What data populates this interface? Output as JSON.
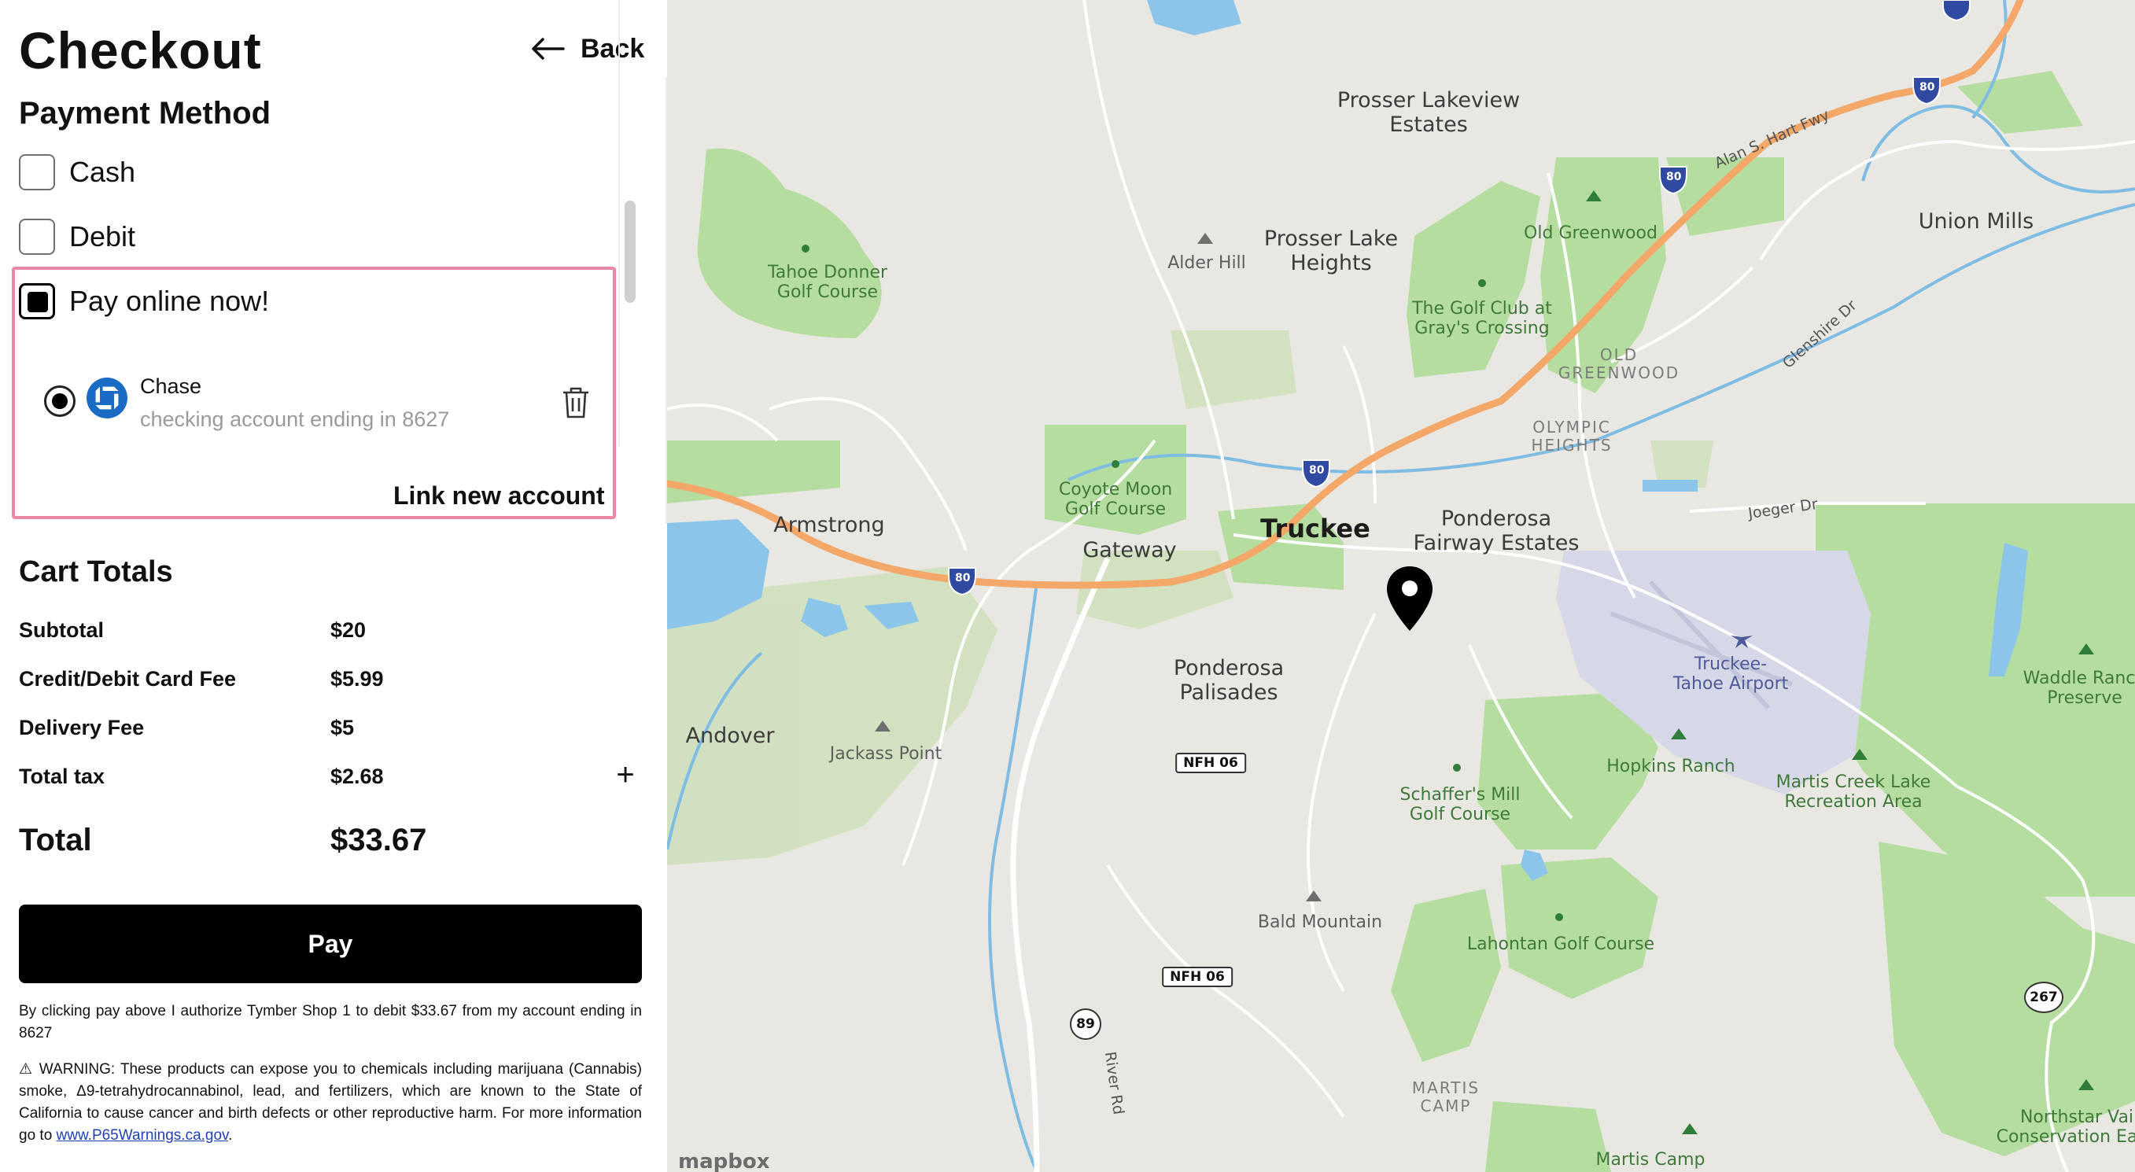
{
  "header": {
    "title": "Checkout",
    "back_label": "Back"
  },
  "payment": {
    "heading": "Payment Method",
    "options": [
      {
        "label": "Cash",
        "checked": false
      },
      {
        "label": "Debit",
        "checked": false
      },
      {
        "label": "Pay online now!",
        "checked": true
      }
    ],
    "account": {
      "bank": "Chase",
      "detail": "checking account ending in 8627",
      "selected": true
    },
    "link_new_account": "Link new account"
  },
  "cart": {
    "heading": "Cart Totals",
    "rows": [
      {
        "label": "Subtotal",
        "value": "$20"
      },
      {
        "label": "Credit/Debit Card Fee",
        "value": "$5.99"
      },
      {
        "label": "Delivery Fee",
        "value": "$5"
      },
      {
        "label": "Total tax",
        "value": "$2.68"
      }
    ],
    "total_label": "Total",
    "total_value": "$33.67"
  },
  "pay_button": "Pay",
  "legal": {
    "authorization": "By clicking pay above I authorize Tymber Shop 1 to debit $33.67 from my account ending in 8627",
    "warning": "⚠ WARNING: These products can expose you to chemicals including marijuana (Cannabis) smoke, Δ9-tetrahydrocannabinol, lead, and fertilizers, which are known to the State of California to cause cancer and birth defects or other reproductive harm. For more information go to",
    "warning_link": "www.P65Warnings.ca.gov",
    "warning_end": "."
  },
  "map": {
    "labels": {
      "prosser_lakeview": "Prosser Lakeview\nEstates",
      "prosser_lake_heights": "Prosser Lake\nHeights",
      "alder_hill": "Alder Hill",
      "tahoe_donner": "Tahoe Donner\nGolf Course",
      "old_greenwood": "Old Greenwood",
      "golf_club": "The Golf Club at\nGray's Crossing",
      "old_greenwood_caps": "OLD\nGREENWOOD",
      "olympic_heights": "OLYMPIC\nHEIGHTS",
      "union_mills": "Union Mills",
      "coyote_moon": "Coyote Moon\nGolf Course",
      "armstrong": "Armstrong",
      "gateway": "Gateway",
      "truckee": "Truckee",
      "ponderosa_fairway": "Ponderosa\nFairway Estates",
      "ponderosa_palisades": "Ponderosa\nPalisades",
      "andover": "Andover",
      "jackass_point": "Jackass Point",
      "truckee_airport": "Truckee-\nTahoe Airport",
      "schaffers_mill": "Schaffer's Mill\nGolf Course",
      "hopkins_ranch": "Hopkins Ranch",
      "martis_creek": "Martis Creek Lake\nRecreation Area",
      "waddle_ranch": "Waddle Ranch\nPreserve",
      "bald_mountain": "Bald Mountain",
      "lahontan": "Lahontan Golf Course",
      "martis_camp_caps": "MARTIS\nCAMP",
      "martis_camp": "Martis Camp",
      "northstar": "Northstar Vai\nConservation Ease"
    },
    "roads": {
      "alan_hart": "Alan S. Hart Fwy",
      "glenshire": "Glenshire Dr",
      "joeger": "Joeger Dr",
      "river_rd": "River Rd"
    },
    "routes": {
      "i80": "80",
      "nfh06": "NFH 06",
      "r89": "89",
      "r267": "267"
    },
    "attribution": "mapbox"
  }
}
